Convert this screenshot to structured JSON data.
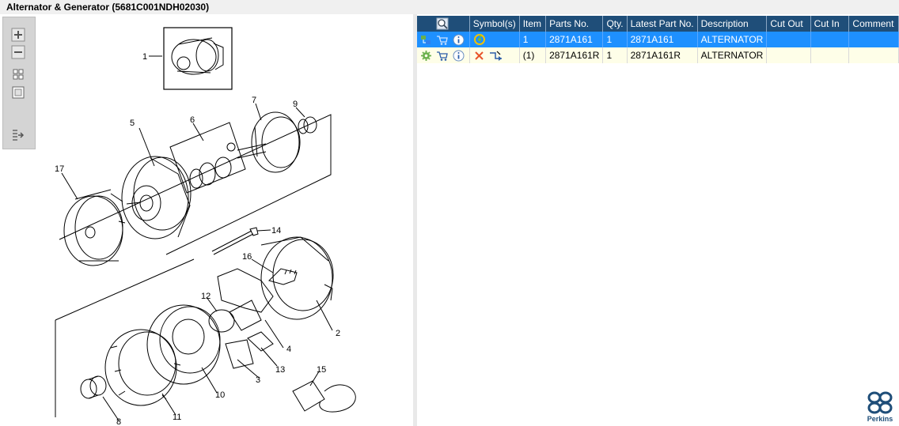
{
  "window": {
    "title": "Alternator & Generator (5681C001NDH02030)"
  },
  "toolbar": {
    "buttons": [
      "zoom-in",
      "zoom-out",
      "fit-all",
      "actual-size",
      "export"
    ]
  },
  "diagram": {
    "callouts": [
      "1",
      "2",
      "3",
      "4",
      "5",
      "6",
      "7",
      "8",
      "9",
      "10",
      "11",
      "12",
      "13",
      "14",
      "15",
      "16",
      "17"
    ]
  },
  "parts_table": {
    "columns": [
      "Symbol(s)",
      "Item",
      "Parts No.",
      "Qty.",
      "Latest Part No.",
      "Description",
      "Cut Out",
      "Cut In",
      "Comment"
    ],
    "rows": [
      {
        "item": "1",
        "parts_no": "2871A161",
        "qty": "1",
        "latest_part_no": "2871A161",
        "description": "ALTERNATOR",
        "cut_out": "",
        "cut_in": "",
        "comment": "",
        "selected": true
      },
      {
        "item": "(1)",
        "parts_no": "2871A161R",
        "qty": "1",
        "latest_part_no": "2871A161R",
        "description": "ALTERNATOR",
        "cut_out": "",
        "cut_in": "",
        "comment": "",
        "selected": false
      }
    ]
  },
  "brand": {
    "name": "Perkins",
    "color": "#1f4e79"
  },
  "colors": {
    "header": "#1f4e79",
    "selected_row": "#1e90ff",
    "row_bg": "#fefee8"
  }
}
